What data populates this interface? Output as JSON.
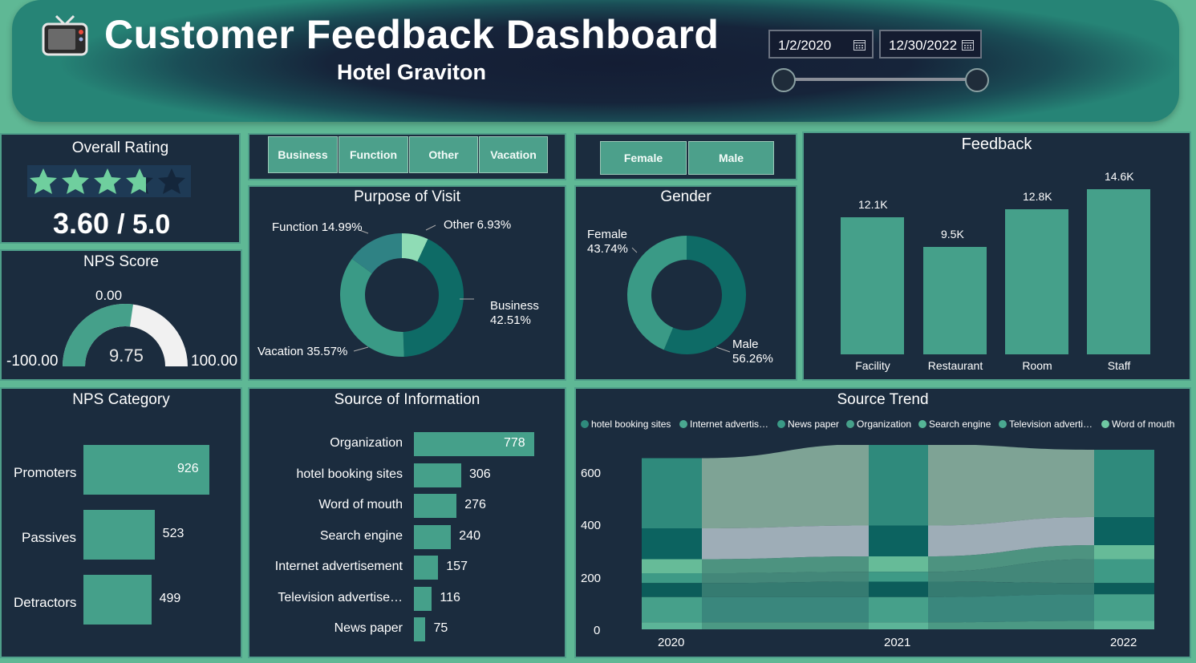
{
  "header": {
    "title": "Customer Feedback Dashboard",
    "subtitle": "Hotel Graviton",
    "tv_icon": "tv-icon",
    "date_start": "1/2/2020",
    "date_end": "12/30/2022"
  },
  "overall_rating": {
    "title": "Overall Rating",
    "value": "3.60",
    "max": "/ 5.0",
    "stars_filled": 3.6,
    "stars_total": 5
  },
  "nps_score": {
    "title": "NPS Score",
    "top": "0.00",
    "min": "-100.00",
    "max": "100.00",
    "value": "9.75"
  },
  "nps_category": {
    "title": "NPS Category",
    "categories": [
      "Promoters",
      "Passives",
      "Detractors"
    ],
    "values": [
      926,
      523,
      499
    ],
    "value_labels": [
      "926",
      "523",
      "499"
    ]
  },
  "filters": {
    "purpose_buttons": [
      "Business",
      "Function",
      "Other",
      "Vacation"
    ],
    "gender_buttons": [
      "Female",
      "Male"
    ]
  },
  "purpose": {
    "title": "Purpose of Visit",
    "labels": {
      "function": "Function 14.99%",
      "other": "Other 6.93%",
      "business": "Business",
      "business_pct": "42.51%",
      "vacation": "Vacation 35.57%"
    }
  },
  "gender": {
    "title": "Gender",
    "labels": {
      "female": "Female",
      "female_pct": "43.74%",
      "male": "Male",
      "male_pct": "56.26%"
    }
  },
  "feedback": {
    "title": "Feedback",
    "categories": [
      "Facility",
      "Restaurant",
      "Room",
      "Staff"
    ],
    "values": [
      12.1,
      9.5,
      12.8,
      14.6
    ],
    "value_labels": [
      "12.1K",
      "9.5K",
      "12.8K",
      "14.6K"
    ]
  },
  "source_info": {
    "title": "Source of Information",
    "categories": [
      "Organization",
      "hotel booking sites",
      "Word of mouth",
      "Search engine",
      "Internet advertisement",
      "Television advertise…",
      "News paper"
    ],
    "values": [
      778,
      306,
      276,
      240,
      157,
      116,
      75
    ],
    "value_labels": [
      "778",
      "306",
      "276",
      "240",
      "157",
      "116",
      "75"
    ]
  },
  "source_trend": {
    "title": "Source Trend",
    "legend": [
      "hotel booking sites",
      "Internet advertis…",
      "News paper",
      "Organization",
      "Search engine",
      "Television adverti…",
      "Word of mouth"
    ],
    "y_ticks": [
      "0",
      "200",
      "400",
      "600"
    ],
    "x_ticks": [
      "2020",
      "2021",
      "2022"
    ]
  },
  "colors": {
    "accent": "#45a08a",
    "panel": "#1b2c3e",
    "page": "#5fb895",
    "donut_dark": "#0e6b66",
    "donut_mid": "#3a9a86",
    "donut_light": "#8fdcb5",
    "donut_teal": "#2f8284"
  },
  "chart_data": [
    {
      "type": "bar",
      "title": "Feedback",
      "categories": [
        "Facility",
        "Restaurant",
        "Room",
        "Staff"
      ],
      "values": [
        12100,
        9500,
        12800,
        14600
      ]
    },
    {
      "type": "pie",
      "title": "Purpose of Visit",
      "categories": [
        "Business",
        "Vacation",
        "Function",
        "Other"
      ],
      "values": [
        42.51,
        35.57,
        14.99,
        6.93
      ]
    },
    {
      "type": "pie",
      "title": "Gender",
      "categories": [
        "Female",
        "Male"
      ],
      "values": [
        43.74,
        56.26
      ]
    },
    {
      "type": "bar",
      "title": "NPS Category",
      "categories": [
        "Promoters",
        "Passives",
        "Detractors"
      ],
      "values": [
        926,
        523,
        499
      ]
    },
    {
      "type": "bar",
      "title": "Source of Information",
      "categories": [
        "Organization",
        "hotel booking sites",
        "Word of mouth",
        "Search engine",
        "Internet advertisement",
        "Television advertise…",
        "News paper"
      ],
      "values": [
        778,
        306,
        276,
        240,
        157,
        116,
        75
      ]
    },
    {
      "type": "area",
      "title": "Source Trend",
      "x": [
        "2020",
        "2021",
        "2022"
      ],
      "ylim": [
        0,
        600
      ],
      "series": [
        {
          "name": "hotel booking sites",
          "values": [
            250,
            290,
            240
          ]
        },
        {
          "name": "Internet advertis…",
          "values": [
            110,
            110,
            100
          ]
        },
        {
          "name": "News paper",
          "values": [
            50,
            55,
            50
          ]
        },
        {
          "name": "Organization",
          "values": [
            35,
            35,
            85
          ]
        },
        {
          "name": "Search engine",
          "values": [
            50,
            55,
            40
          ]
        },
        {
          "name": "Television adverti…",
          "values": [
            90,
            90,
            95
          ]
        },
        {
          "name": "Word of mouth",
          "values": [
            25,
            25,
            30
          ]
        }
      ]
    }
  ]
}
